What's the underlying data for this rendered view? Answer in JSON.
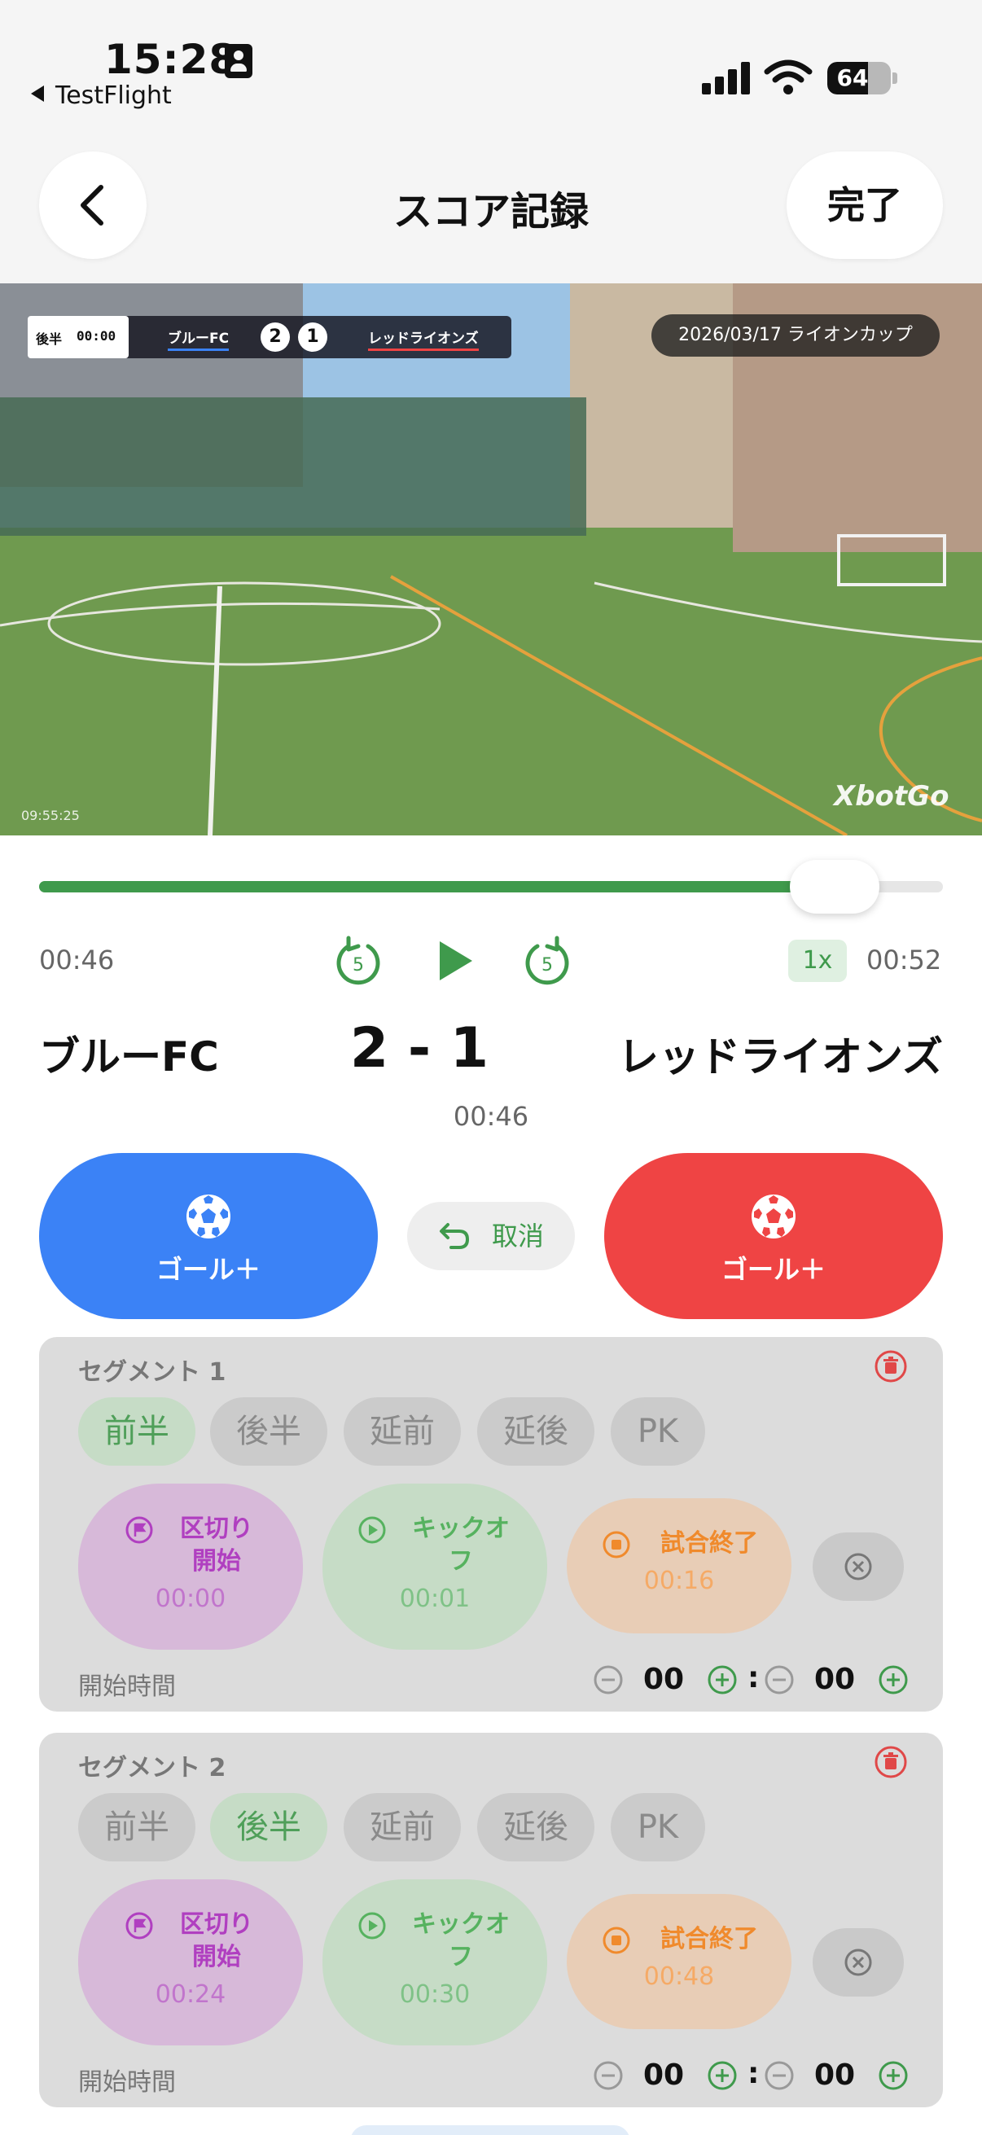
{
  "status_bar": {
    "time": "15:28",
    "back_app": "TestFlight",
    "battery": "64"
  },
  "nav": {
    "title": "スコア記録",
    "done_label": "完了"
  },
  "video_overlay": {
    "half": "後半",
    "clock": "00:00",
    "team_a": "ブルーFC",
    "score_a": "2",
    "score_b": "1",
    "team_b": "レッドライオンズ",
    "date_event": "2026/03/17 ライオンカップ",
    "watermark": "XbotGo",
    "timestamp": "09:55:25"
  },
  "player": {
    "current_time": "00:46",
    "total_time": "00:52",
    "progress": 0.88,
    "speed": "1x",
    "skip_back_label": "5",
    "skip_forward_label": "5"
  },
  "scoreboard": {
    "team_left": "ブルーFC",
    "team_right": "レッドライオンズ",
    "score": "2 - 1",
    "time": "00:46"
  },
  "actions": {
    "goal_left_label": "ゴール＋",
    "goal_right_label": "ゴール＋",
    "cancel_label": "取消",
    "blue_color": "#3b82f6",
    "red_color": "#ef4444"
  },
  "segments": [
    {
      "title": "セグメント 1",
      "chips": [
        "前半",
        "後半",
        "延前",
        "延後",
        "PK"
      ],
      "active_chip": 0,
      "mark_start_label": "区切り\n開始",
      "mark_start_time": "00:00",
      "kickoff_label": "キックオ\nフ",
      "kickoff_time": "00:01",
      "end_label": "試合終了",
      "end_time": "00:16",
      "start_time_label": "開始時間",
      "minutes": "00",
      "seconds": "00"
    },
    {
      "title": "セグメント 2",
      "chips": [
        "前半",
        "後半",
        "延前",
        "延後",
        "PK"
      ],
      "active_chip": 1,
      "mark_start_label": "区切り\n開始",
      "mark_start_time": "00:24",
      "kickoff_label": "キックオ\nフ",
      "kickoff_time": "00:30",
      "end_label": "試合終了",
      "end_time": "00:48",
      "start_time_label": "開始時間",
      "minutes": "00",
      "seconds": "00"
    }
  ],
  "icons": {
    "back": "chevron-left-icon",
    "play": "play-icon",
    "skip_back": "rewind-5-icon",
    "skip_forward": "forward-5-icon",
    "ball": "soccer-ball-icon",
    "undo": "undo-arrow-icon",
    "trash": "trash-icon",
    "flag": "flag-icon",
    "kickoff": "play-circle-icon",
    "stop": "stop-circle-icon",
    "close": "close-circle-icon",
    "minus": "minus-circle-icon",
    "plus": "plus-circle-icon"
  }
}
